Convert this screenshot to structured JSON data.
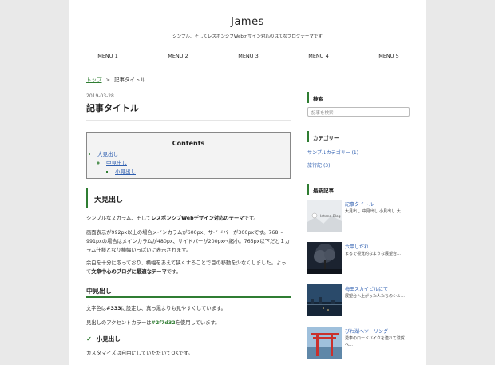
{
  "site": {
    "title": "James",
    "description": "シンプル、そしてレスポンシブWebデザイン対応のはてなブログテーマです"
  },
  "nav": [
    "MENU 1",
    "MENU 2",
    "MENU 3",
    "MENU 4",
    "MENU 5"
  ],
  "breadcrumb": {
    "home": "トップ",
    "separator": ">",
    "current": "記事タイトル"
  },
  "article": {
    "date": "2019-03-28",
    "title": "記事タイトル",
    "toc": {
      "heading": "Contents",
      "items": [
        "大見出し",
        "中見出し",
        "小見出し"
      ]
    },
    "h2": "大見出し",
    "p1_a": "シンプルな２カラム、そして",
    "p1_b": "レスポンシブWebデザイン対応のテーマ",
    "p1_c": "です。",
    "p2": "画面表示が992px以上の場合メインカラムが600px、サイドバーが300pxです。768〜991pxの場合はメインカラムが480px、サイドバーが200pxへ縮小。765px以下だと１カラム仕様となり横幅いっぱいに表示されます。",
    "p3_a": "余白を十分に取っており、横幅をあえて狭くすることで目の移動を少なくしました。よって",
    "p3_b": "文章中心のブログに最適なテーマ",
    "p3_c": "です。",
    "h3": "中見出し",
    "p4_a": "文字色は",
    "p4_b": "#333",
    "p4_c": "に設定し、真っ黒よりも見やすくしています。",
    "p5_a": "見出しのアクセントカラーは",
    "p5_b": "#2f7d32",
    "p5_c": "を使用しています。",
    "h4": "小見出し",
    "p6": "カスタマイズは自由にしていただいてOKです。"
  },
  "sidebar": {
    "search_heading": "検索",
    "search_placeholder": "記事を検索",
    "category_heading": "カテゴリー",
    "categories": [
      {
        "name": "サンプルカテゴリー",
        "count": "(1)"
      },
      {
        "name": "旅行記",
        "count": "(3)"
      }
    ],
    "recent_heading": "最新記事",
    "recent": [
      {
        "title": "記事タイトル",
        "summary": "大見出し 中見出し 小見出し 大…",
        "thumb": "hatena-blog-icon"
      },
      {
        "title": "六甲しだれ",
        "summary": "まるで視覚的なような展望台…",
        "thumb": "night-tree-photo"
      },
      {
        "title": "梅田スカイビルにて",
        "summary": "展望台へ上がった人たちのシル…",
        "thumb": "city-night-photo"
      },
      {
        "title": "びわ湖ヘツーリング",
        "summary": "愛車のロードバイクを連れて滋賀へ…",
        "thumb": "torii-lake-photo"
      }
    ]
  },
  "colors": {
    "accent": "#2f7d32",
    "text": "#333333",
    "link": "#2f5fb0"
  }
}
